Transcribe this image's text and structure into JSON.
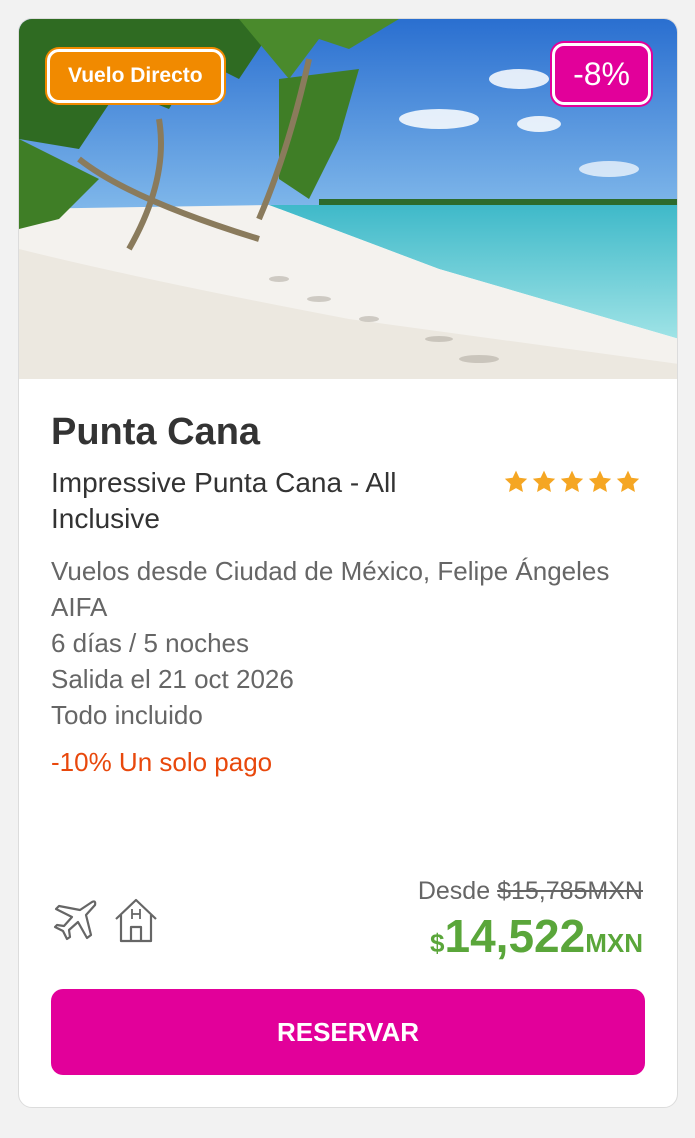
{
  "badges": {
    "direct_flight": "Vuelo Directo",
    "discount": "-8%"
  },
  "destination": "Punta Cana",
  "hotel_name": "Impressive Punta Cana - All Inclusive",
  "rating_stars": 5,
  "details": {
    "flights": "Vuelos desde Ciudad de México, Felipe Ángeles AIFA",
    "duration": "6 días / 5 noches",
    "departure": "Salida el 21 oct 2026",
    "plan": "Todo incluido"
  },
  "promo": "-10% Un solo pago",
  "pricing": {
    "from_label": "Desde",
    "original_price": "$15,785MXN",
    "currency_symbol": "$",
    "price": "14,522",
    "currency": "MXN"
  },
  "button": {
    "label": "RESERVAR"
  },
  "colors": {
    "brand_magenta": "#e2009a",
    "badge_orange": "#f18a00",
    "price_green": "#5aa63a",
    "promo_orange": "#e8480c",
    "star_gold": "#f5a623"
  }
}
